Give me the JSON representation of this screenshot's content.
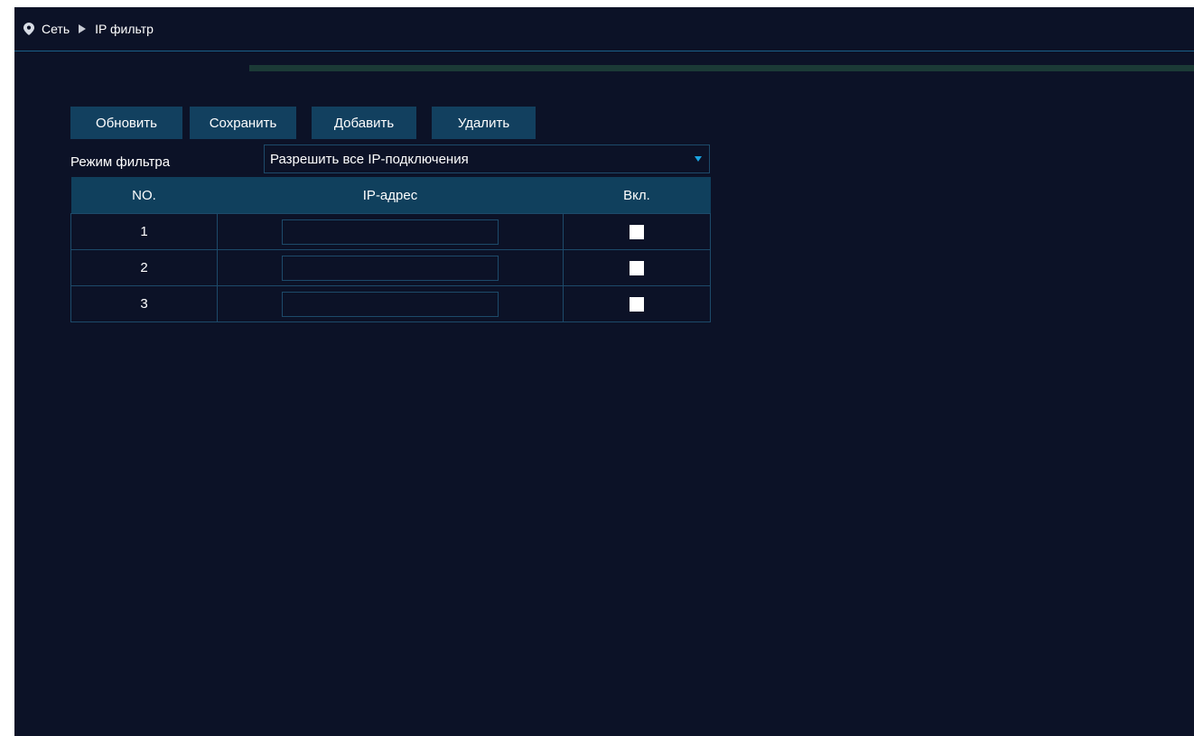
{
  "breadcrumb": {
    "root": "Сеть",
    "current": "IP фильтр",
    "pin_icon": "location-pin-icon",
    "separator_icon": "triangle-right-icon"
  },
  "progress": {
    "value": 1.0
  },
  "toolbar": {
    "refresh_label": "Обновить",
    "save_label": "Сохранить",
    "add_label": "Добавить",
    "delete_label": "Удалить"
  },
  "filter_mode": {
    "label": "Режим фильтра",
    "value": "Разрешить все IP-подключения"
  },
  "table": {
    "headers": [
      "NO.",
      "IP-адрес",
      "Вкл."
    ],
    "rows": [
      {
        "no": "1",
        "ip": "",
        "enabled": false
      },
      {
        "no": "2",
        "ip": "",
        "enabled": false
      },
      {
        "no": "3",
        "ip": "",
        "enabled": false
      }
    ]
  },
  "colors": {
    "background": "#0c1227",
    "button": "#12405f",
    "table_header": "#10405d",
    "border": "#1d4a6a",
    "accent": "#1aa3e0"
  }
}
